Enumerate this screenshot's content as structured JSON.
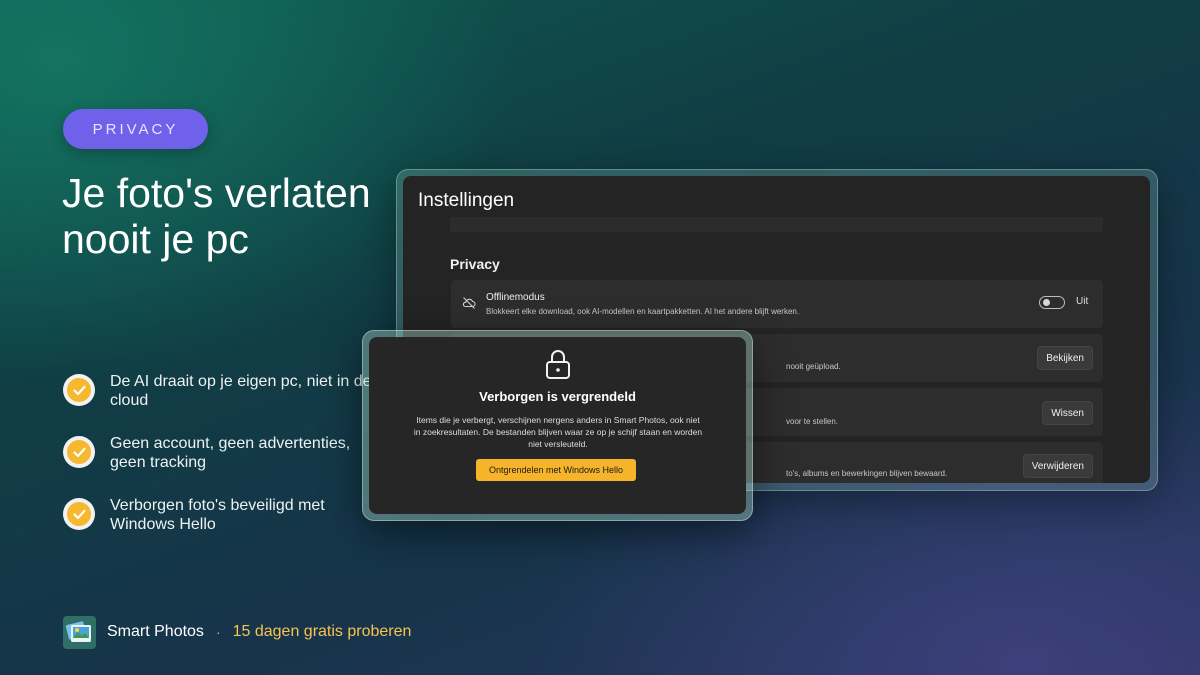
{
  "badge": "PRIVACY",
  "headline": "Je foto's verlaten nooit je pc",
  "features": [
    "De AI draait op je eigen pc, niet in de cloud",
    "Geen account, geen advertenties, geen tracking",
    "Verborgen foto's beveiligd met Windows Hello"
  ],
  "footer": {
    "app_name": "Smart Photos",
    "separator": "·",
    "trial": "15 dagen gratis proberen"
  },
  "settings": {
    "title": "Instellingen",
    "section": "Privacy",
    "rows": [
      {
        "title": "Offlinemodus",
        "desc": "Blokkeert elke download, ook AI-modellen en kaartpakketten. AI het andere blijft werken.",
        "toggle_label": "Uit",
        "toggle_on": false
      },
      {
        "desc": "nooit geüpload.",
        "button": "Bekijken"
      },
      {
        "desc": "voor te stellen.",
        "button": "Wissen"
      },
      {
        "desc": "to's, albums en bewerkingen blijven bewaard.",
        "button": "Verwijderen"
      }
    ]
  },
  "dialog": {
    "title": "Verborgen is vergrendeld",
    "text": "Items die je verbergt, verschijnen nergens anders in Smart Photos, ook niet in zoekresultaten. De bestanden blijven waar ze op je schijf staan en worden niet versleuteld.",
    "button": "Ontgrendelen met Windows Hello"
  },
  "colors": {
    "badge": "#7061ea",
    "accent": "#f5b429",
    "trial_text": "#f7c44e"
  }
}
